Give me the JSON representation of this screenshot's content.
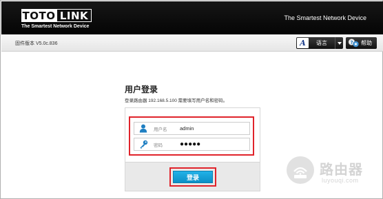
{
  "header": {
    "logo_left": "TOTO",
    "logo_right": "LINK",
    "logo_tagline": "The Smartest Network Device",
    "slogan": "The Smartest Network Device"
  },
  "toolbar": {
    "firmware_version": "固件版本 V5.0c.836",
    "language_label": "语言",
    "language_icon": "A",
    "help_label": "帮助"
  },
  "login": {
    "title": "用户登录",
    "description": "登录路由器 192.168.5.100 需要填写用户名和密码。",
    "username_label": "用户名",
    "username_value": "admin",
    "password_label": "密码",
    "password_value": "●●●●●",
    "submit_label": "登录"
  },
  "watermark": {
    "main": "路由器",
    "sub": "luyouqi.com"
  },
  "colors": {
    "header_bg": "#0a0a0a",
    "accent_blue": "#1aa3dc",
    "highlight_red": "#e0222a",
    "toolbar_bg": "#eeeeee"
  },
  "icons": {
    "user_field": "user-icon",
    "password_field": "key-icon",
    "help_button": "help-icon",
    "language_button": "language-icon",
    "language_dropdown": "chevron-down-icon"
  }
}
